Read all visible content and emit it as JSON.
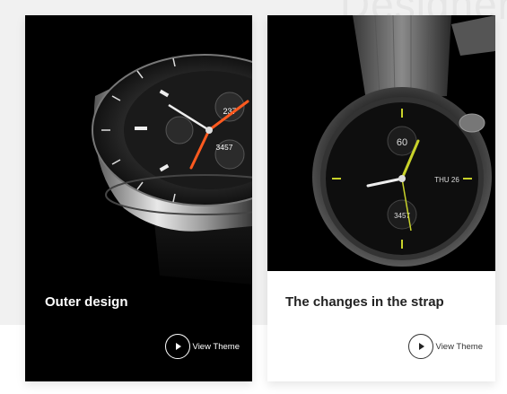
{
  "background": {
    "watermark": "Designer"
  },
  "cards": [
    {
      "title": "Outer design",
      "button_label": "View Theme",
      "watch": {
        "digits_top": "237",
        "digits_bottom": "3457",
        "accent": "#ff5a1f"
      }
    },
    {
      "title": "The changes in the strap",
      "button_label": "View Theme",
      "watch": {
        "digits_top": "60",
        "date": "THU 26",
        "digits_bottom": "3457",
        "accent": "#c8d22a"
      }
    }
  ],
  "colors": {
    "page_bg": "#f1f1f1",
    "card_dark": "#000000",
    "card_light": "#ffffff"
  }
}
